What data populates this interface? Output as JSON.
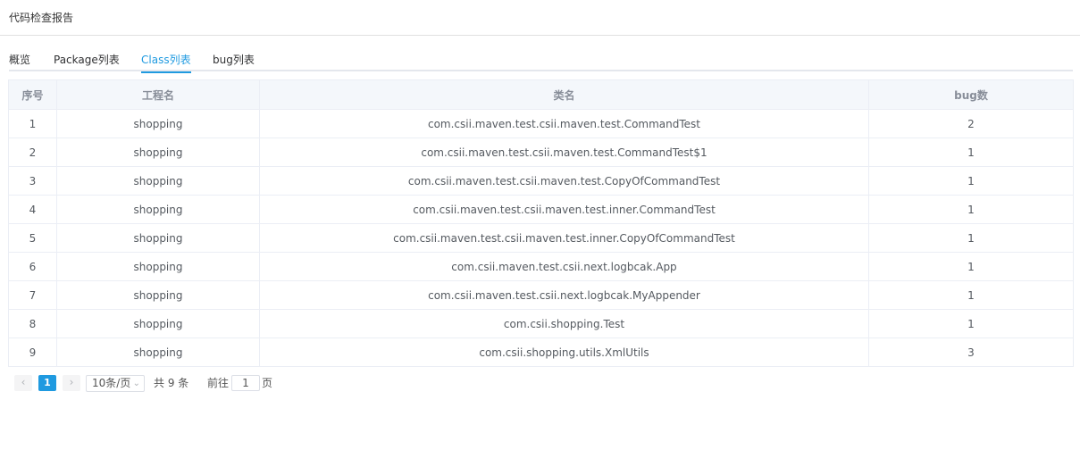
{
  "header": {
    "title": "代码检查报告"
  },
  "tabs": [
    {
      "label": "概览",
      "active": false
    },
    {
      "label": "Package列表",
      "active": false
    },
    {
      "label": "Class列表",
      "active": true
    },
    {
      "label": "bug列表",
      "active": false
    }
  ],
  "table": {
    "columns": [
      "序号",
      "工程名",
      "类名",
      "bug数"
    ],
    "rows": [
      {
        "index": "1",
        "project": "shopping",
        "class_name": "com.csii.maven.test.csii.maven.test.CommandTest",
        "bugs": "2"
      },
      {
        "index": "2",
        "project": "shopping",
        "class_name": "com.csii.maven.test.csii.maven.test.CommandTest$1",
        "bugs": "1"
      },
      {
        "index": "3",
        "project": "shopping",
        "class_name": "com.csii.maven.test.csii.maven.test.CopyOfCommandTest",
        "bugs": "1"
      },
      {
        "index": "4",
        "project": "shopping",
        "class_name": "com.csii.maven.test.csii.maven.test.inner.CommandTest",
        "bugs": "1"
      },
      {
        "index": "5",
        "project": "shopping",
        "class_name": "com.csii.maven.test.csii.maven.test.inner.CopyOfCommandTest",
        "bugs": "1"
      },
      {
        "index": "6",
        "project": "shopping",
        "class_name": "com.csii.maven.test.csii.next.logbcak.App",
        "bugs": "1"
      },
      {
        "index": "7",
        "project": "shopping",
        "class_name": "com.csii.maven.test.csii.next.logbcak.MyAppender",
        "bugs": "1"
      },
      {
        "index": "8",
        "project": "shopping",
        "class_name": "com.csii.shopping.Test",
        "bugs": "1"
      },
      {
        "index": "9",
        "project": "shopping",
        "class_name": "com.csii.shopping.utils.XmlUtils",
        "bugs": "3"
      }
    ]
  },
  "pagination": {
    "prev_glyph": "‹",
    "next_glyph": "›",
    "current_page": "1",
    "page_size": "10条/页",
    "total": "共 9 条",
    "goto_prefix": "前往",
    "goto_value": "1",
    "goto_suffix": "页"
  },
  "colors": {
    "accent": "#1f9ae0",
    "header_bg": "#f4f7fb",
    "border": "#ebeef5"
  }
}
